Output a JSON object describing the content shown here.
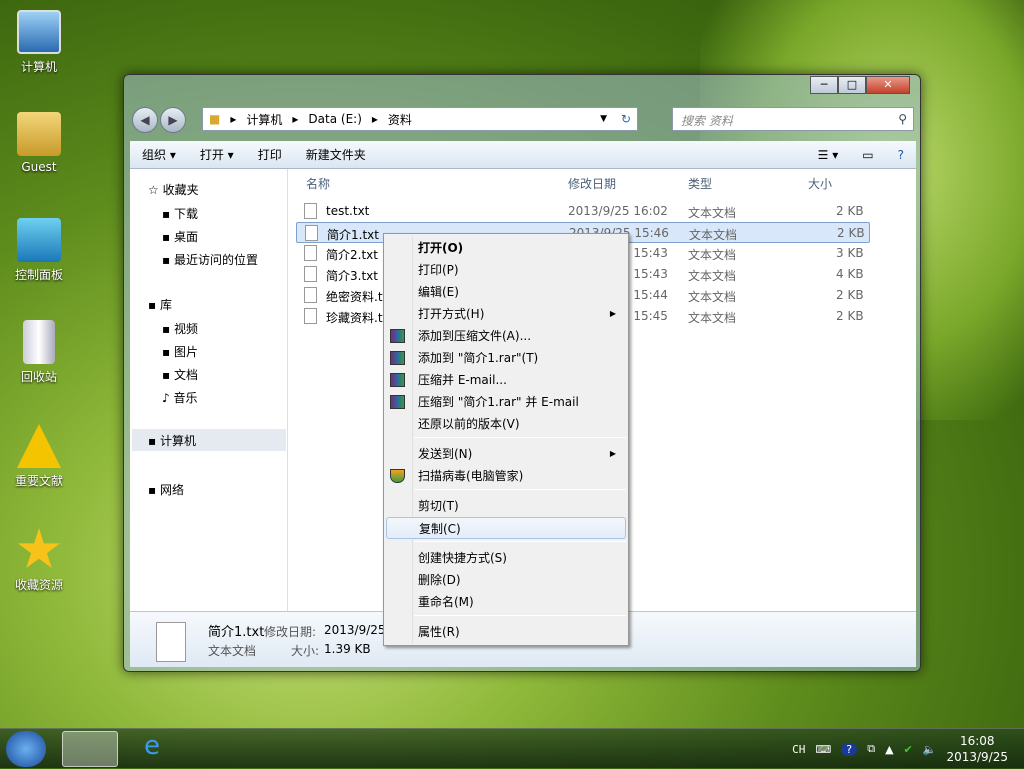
{
  "desktop": {
    "icons": [
      "计算机",
      "Guest",
      "控制面板",
      "回收站",
      "重要文献",
      "收藏资源"
    ]
  },
  "window": {
    "address": [
      "计算机",
      "Data (E:)",
      "资料"
    ],
    "search_placeholder": "搜索 资料",
    "toolbar": {
      "organize": "组织 ▾",
      "open": "打开 ▾",
      "print": "打印",
      "new_folder": "新建文件夹"
    },
    "nav": {
      "favorites": "收藏夹",
      "fav_items": [
        "下载",
        "桌面",
        "最近访问的位置"
      ],
      "libraries": "库",
      "lib_items": [
        "视频",
        "图片",
        "文档",
        "音乐"
      ],
      "computer": "计算机",
      "network": "网络"
    },
    "columns": {
      "name": "名称",
      "date": "修改日期",
      "type": "类型",
      "size": "大小"
    },
    "files": [
      {
        "name": "test.txt",
        "date": "2013/9/25 16:02",
        "type": "文本文档",
        "size": "2 KB"
      },
      {
        "name": "简介1.txt",
        "date": "2013/9/25 15:46",
        "type": "文本文档",
        "size": "2 KB"
      },
      {
        "name": "简介2.txt",
        "date": "2013/9/25 15:43",
        "type": "文本文档",
        "size": "3 KB"
      },
      {
        "name": "简介3.txt",
        "date": "2013/9/25 15:43",
        "type": "文本文档",
        "size": "4 KB"
      },
      {
        "name": "绝密资料.txt",
        "date": "2013/9/25 15:44",
        "type": "文本文档",
        "size": "2 KB"
      },
      {
        "name": "珍藏资料.txt",
        "date": "2013/9/25 15:45",
        "type": "文本文档",
        "size": "2 KB"
      }
    ],
    "details": {
      "name": "简介1.txt",
      "modified_label": "修改日期:",
      "modified": "2013/9/25 15:46",
      "type": "文本文档",
      "size_label": "大小:",
      "size": "1.39 KB"
    }
  },
  "context_menu": [
    "打开(O)",
    "打印(P)",
    "编辑(E)",
    "打开方式(H)",
    "添加到压缩文件(A)...",
    "添加到 \"简介1.rar\"(T)",
    "压缩并 E-mail...",
    "压缩到 \"简介1.rar\" 并 E-mail",
    "还原以前的版本(V)",
    "发送到(N)",
    "扫描病毒(电脑管家)",
    "剪切(T)",
    "复制(C)",
    "创建快捷方式(S)",
    "删除(D)",
    "重命名(M)",
    "属性(R)"
  ],
  "taskbar": {
    "lang": "CH",
    "time": "16:08",
    "date": "2013/9/25"
  }
}
